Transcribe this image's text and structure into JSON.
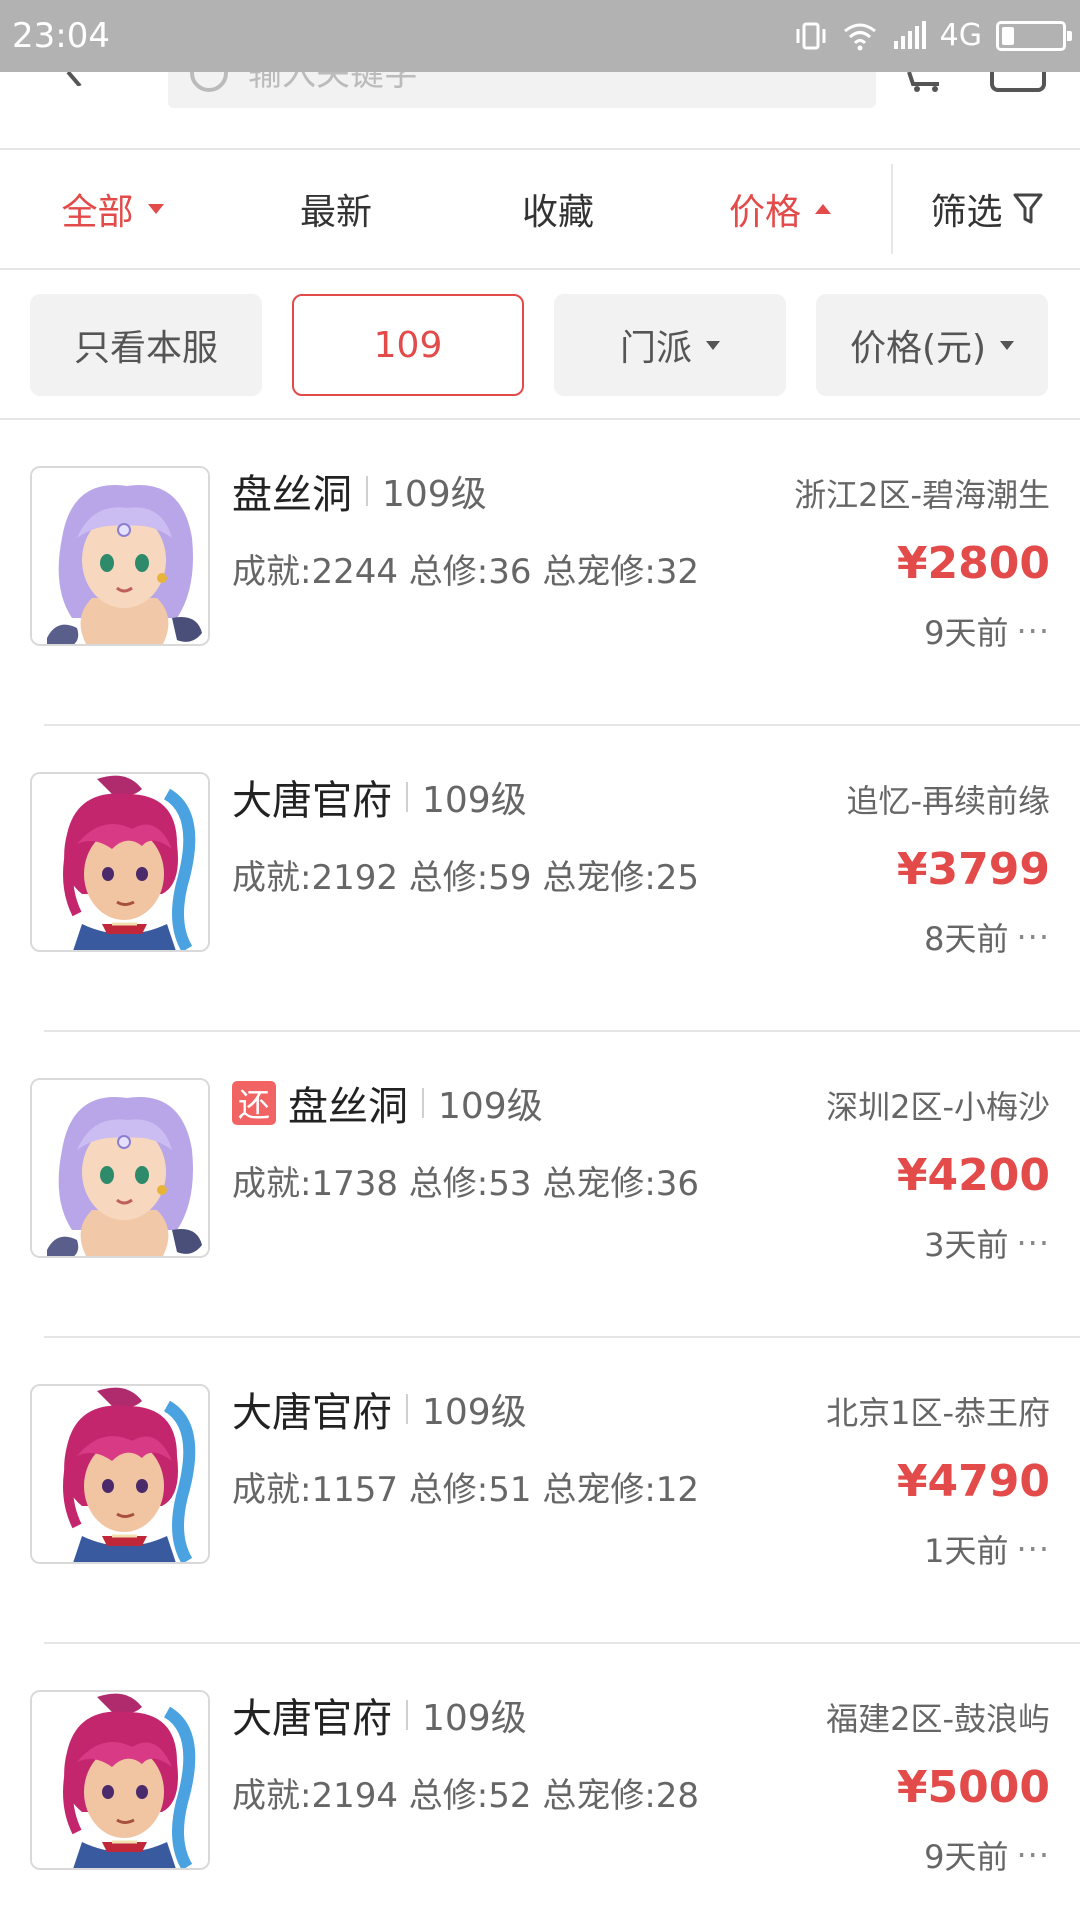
{
  "status_bar": {
    "time": "23:04",
    "network": "4G",
    "battery_level": 0.2,
    "icons": [
      "vibrate-icon",
      "wifi-icon",
      "signal-icon",
      "battery-icon"
    ]
  },
  "search": {
    "placeholder": "输入关键字"
  },
  "sort_tabs": [
    {
      "label": "全部",
      "active": true,
      "indicator": "caret-down"
    },
    {
      "label": "最新",
      "active": false
    },
    {
      "label": "收藏",
      "active": false
    },
    {
      "label": "价格",
      "active": true,
      "indicator": "caret-up"
    }
  ],
  "filter_tab": {
    "label": "筛选",
    "icon": "funnel-icon"
  },
  "chips": [
    {
      "label": "只看本服",
      "selected": false
    },
    {
      "label": "109",
      "selected": true
    },
    {
      "label": "门派",
      "selected": false,
      "dropdown": true
    },
    {
      "label": "价格(元)",
      "selected": false,
      "dropdown": true
    }
  ],
  "listings": [
    {
      "badge": "",
      "name": "盘丝洞",
      "level": "109级",
      "server": "浙江2区-碧海潮生",
      "stats": "成就:2244 总修:36 总宠修:32",
      "price": "¥2800",
      "time": "9天前",
      "avatar": "spider-cave-female-avatar"
    },
    {
      "badge": "",
      "name": "大唐官府",
      "level": "109级",
      "server": "追忆-再续前缘",
      "stats": "成就:2192 总修:59 总宠修:25",
      "price": "¥3799",
      "time": "8天前",
      "avatar": "datang-male-avatar"
    },
    {
      "badge": "还",
      "name": "盘丝洞",
      "level": "109级",
      "server": "深圳2区-小梅沙",
      "stats": "成就:1738 总修:53 总宠修:36",
      "price": "¥4200",
      "time": "3天前",
      "avatar": "spider-cave-female-avatar"
    },
    {
      "badge": "",
      "name": "大唐官府",
      "level": "109级",
      "server": "北京1区-恭王府",
      "stats": "成就:1157 总修:51 总宠修:12",
      "price": "¥4790",
      "time": "1天前",
      "avatar": "datang-male-avatar"
    },
    {
      "badge": "",
      "name": "大唐官府",
      "level": "109级",
      "server": "福建2区-鼓浪屿",
      "stats": "成就:2194 总修:52 总宠修:28",
      "price": "¥5000",
      "time": "9天前",
      "avatar": "datang-male-avatar"
    }
  ],
  "more_glyph": "···",
  "colors": {
    "accent": "#e34a4a",
    "status_bar": "#b2b2b2",
    "chip_bg": "#f2f2f2",
    "badge": "#f26464"
  }
}
